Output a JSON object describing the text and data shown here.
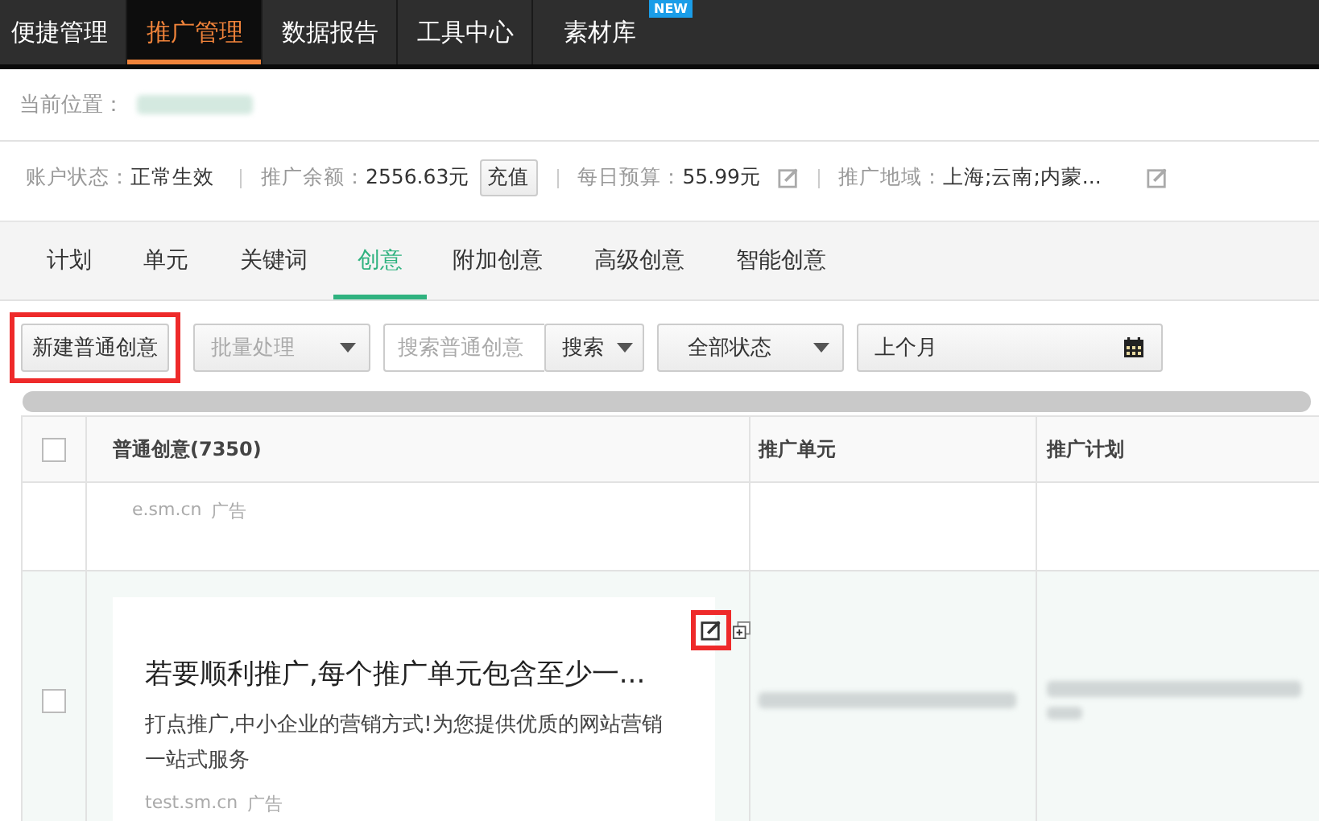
{
  "nav": {
    "items": [
      {
        "label": "便捷管理",
        "selected": false
      },
      {
        "label": "推广管理",
        "selected": true
      },
      {
        "label": "数据报告",
        "selected": false
      },
      {
        "label": "工具中心",
        "selected": false
      },
      {
        "label": "素材库",
        "selected": false,
        "badge": "NEW"
      }
    ]
  },
  "breadcrumb": {
    "label": "当前位置：",
    "redacted": true
  },
  "account": [
    {
      "label": "账户状态：",
      "value": "正常生效"
    },
    {
      "label": "推广余额：",
      "value": "2556.63元",
      "action": "充值"
    },
    {
      "label": "每日预算：",
      "value": "55.99元",
      "editable": true
    },
    {
      "label": "推广地域：",
      "value": "上海;云南;内蒙...",
      "editable": true
    }
  ],
  "tabs": [
    {
      "label": "计划",
      "selected": false
    },
    {
      "label": "单元",
      "selected": false
    },
    {
      "label": "关键词",
      "selected": false
    },
    {
      "label": "创意",
      "selected": true
    },
    {
      "label": "附加创意",
      "selected": false
    },
    {
      "label": "高级创意",
      "selected": false
    },
    {
      "label": "智能创意",
      "selected": false
    }
  ],
  "toolbar": {
    "new_button": {
      "label": "新建普通创意",
      "highlighted": true
    },
    "batch": {
      "label": "批量处理",
      "disabled": true
    },
    "search": {
      "placeholder": "搜索普通创意",
      "button": "搜索"
    },
    "status": {
      "label": "全部状态"
    },
    "date": {
      "label": "上个月"
    }
  },
  "table": {
    "header_checked": false,
    "columns": [
      "普通创意(7350)",
      "推广单元",
      "推广计划"
    ],
    "rows": [
      {
        "hovered": false,
        "url": "e.sm.cn",
        "tag": "广告",
        "redacted_cells": false
      },
      {
        "checked": false,
        "hovered": true,
        "edit_highlighted": true,
        "title": "若要顺利推广,每个推广单元包含至少一...",
        "description": "打点推广,中小企业的营销方式!为您提供优质的网站营销一站式服务",
        "url": "test.sm.cn",
        "tag": "广告",
        "redacted_cells": true
      }
    ]
  }
}
